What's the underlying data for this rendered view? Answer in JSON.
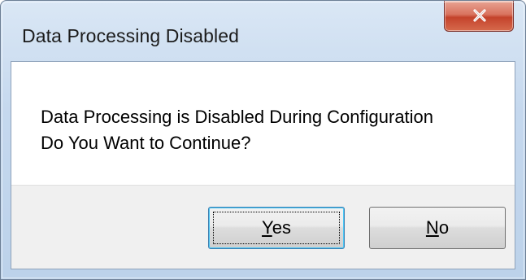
{
  "window": {
    "title": "Data Processing Disabled",
    "close_glyph": "x"
  },
  "message": {
    "line1": "Data Processing is Disabled During Configuration",
    "line2": "Do You Want to Continue?"
  },
  "buttons": {
    "yes": {
      "mnemonic": "Y",
      "rest": "es"
    },
    "no": {
      "mnemonic": "N",
      "rest": "o"
    }
  },
  "colors": {
    "frame": "#c5d8ee",
    "close_button": "#c4432c",
    "footer": "#f0f0f0",
    "default_button_focus": "#48c6f5"
  },
  "icons": {
    "close": "close-icon"
  }
}
